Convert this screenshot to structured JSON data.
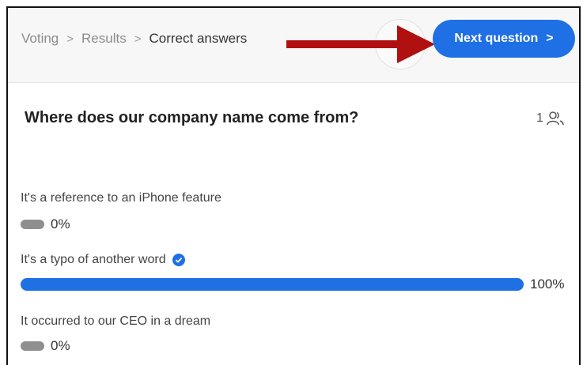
{
  "breadcrumb": {
    "items": [
      "Voting",
      "Results",
      "Correct answers"
    ],
    "separator": ">"
  },
  "next_button": {
    "label": "Next question",
    "chevron": ">"
  },
  "question": {
    "title": "Where does our company name come from?",
    "participants": "1"
  },
  "options": [
    {
      "label": "It's a reference to an iPhone feature",
      "percent_label": "0%",
      "percent": 0,
      "correct": false
    },
    {
      "label": "It's a typo of another word",
      "percent_label": "100%",
      "percent": 100,
      "correct": true
    },
    {
      "label": "It occurred to our CEO in a dream",
      "percent_label": "0%",
      "percent": 0,
      "correct": false
    }
  ],
  "colors": {
    "accent": "#1f6fe5",
    "annotation_arrow": "#b01010",
    "empty_bar": "#8f8f8f"
  },
  "icons": {
    "participants": "people-icon",
    "correct": "check-circle-icon",
    "annotation": "red-arrow-icon"
  }
}
